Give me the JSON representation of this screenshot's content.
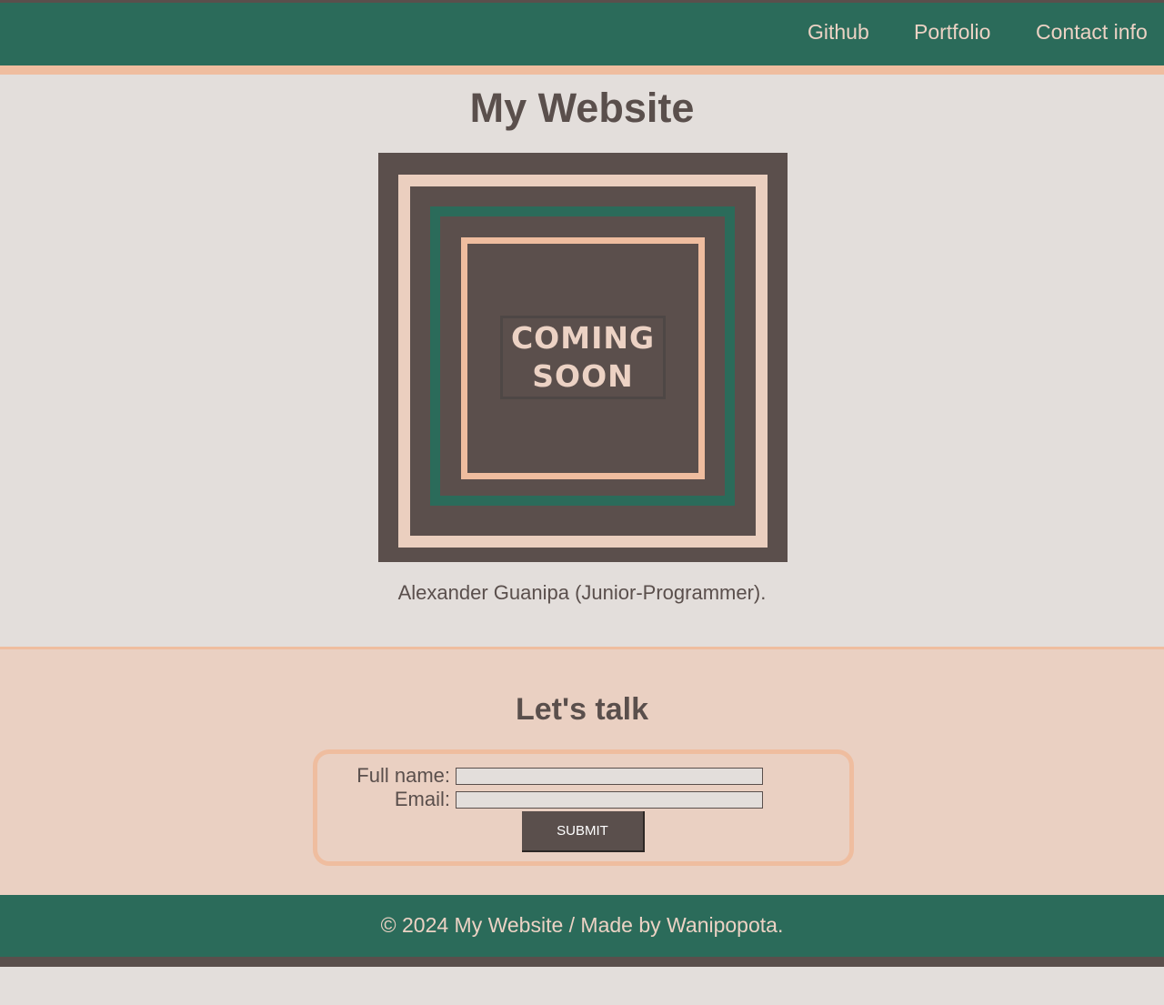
{
  "nav": {
    "links": [
      {
        "label": "Github"
      },
      {
        "label": "Portfolio"
      },
      {
        "label": "Contact info"
      }
    ]
  },
  "hero": {
    "title": "My Website",
    "image": {
      "text_line1": "COMING",
      "text_line2": "SOON"
    },
    "caption": "Alexander Guanipa (Junior-Programmer)."
  },
  "contact": {
    "title": "Let's talk",
    "full_name_label": "Full name:",
    "full_name_value": "",
    "email_label": "Email:",
    "email_value": "",
    "submit_label": "SUBMIT"
  },
  "footer": {
    "text": "© 2024 My Website / Made by Wanipopota."
  },
  "colors": {
    "primary_green": "#2b6b5a",
    "accent_peach": "#efbd9f",
    "text_brown": "#5a4f4c",
    "background": "#e3dedb",
    "contact_background": "#ead0c2"
  }
}
